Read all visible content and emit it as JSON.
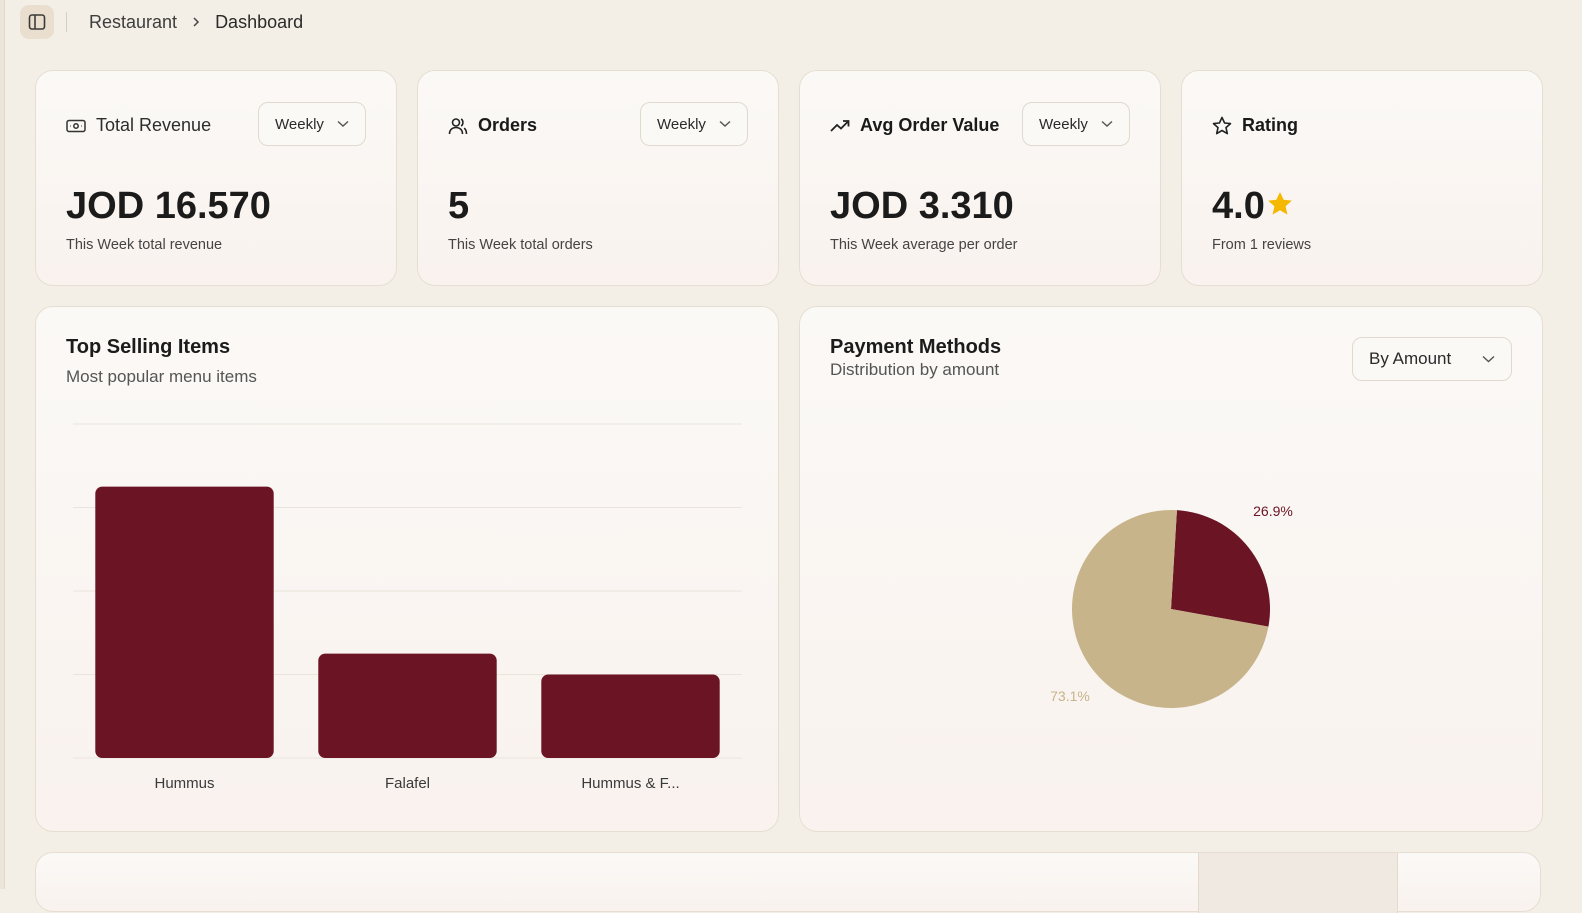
{
  "breadcrumb": {
    "parent": "Restaurant",
    "current": "Dashboard"
  },
  "colors": {
    "accent": "#6b1424",
    "secondary": "#c8b48a",
    "background": "#f4efe6",
    "star": "#f5b800"
  },
  "stats": [
    {
      "icon": "banknote-icon",
      "title": "Total Revenue",
      "period": "Weekly",
      "value": "JOD 16.570",
      "subtitle": "This Week total revenue"
    },
    {
      "icon": "users-icon",
      "title": "Orders",
      "period": "Weekly",
      "value": "5",
      "subtitle": "This Week total orders"
    },
    {
      "icon": "trending-up-icon",
      "title": "Avg Order Value",
      "period": "Weekly",
      "value": "JOD 3.310",
      "subtitle": "This Week average per order"
    },
    {
      "icon": "star-icon",
      "title": "Rating",
      "value": "4.0",
      "subtitle": "From 1 reviews"
    }
  ],
  "top_selling": {
    "title": "Top Selling Items",
    "subtitle": "Most popular menu items"
  },
  "payment_methods": {
    "title": "Payment Methods",
    "subtitle": "Distribution by amount",
    "filter": "By Amount"
  },
  "chart_data": [
    {
      "type": "bar",
      "categories": [
        "Hummus",
        "Falafel",
        "Hummus & F..."
      ],
      "values": [
        3.25,
        1.25,
        1.0
      ],
      "ylim": [
        0,
        4
      ],
      "grid": true,
      "color": "#6b1424"
    },
    {
      "type": "pie",
      "labels": [
        "26.9%",
        "73.1%"
      ],
      "values": [
        26.9,
        73.1
      ],
      "colors": [
        "#6b1424",
        "#c8b48a"
      ],
      "legend": "none"
    }
  ]
}
